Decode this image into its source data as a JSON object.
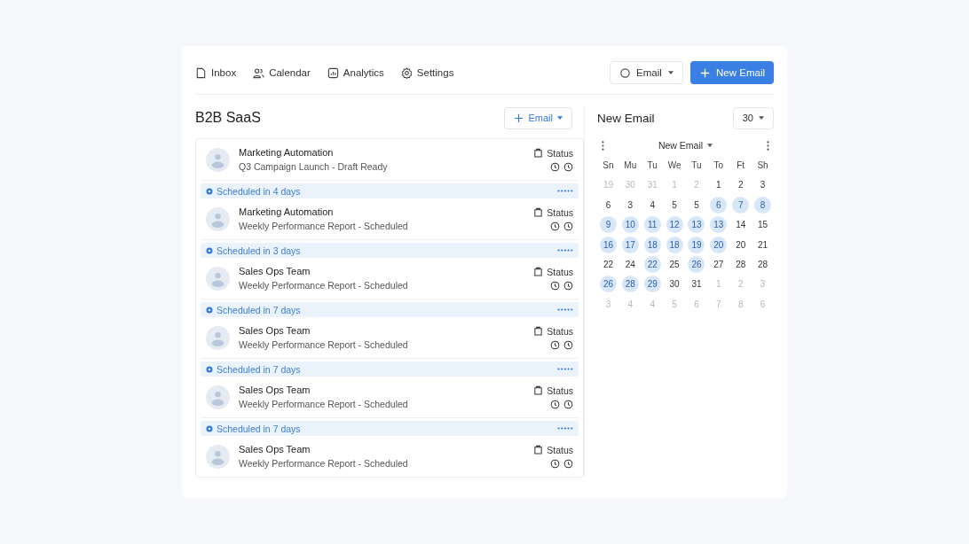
{
  "nav": [
    {
      "label": "Inbox"
    },
    {
      "label": "Calendar"
    },
    {
      "label": "Analytics"
    },
    {
      "label": "Settings"
    }
  ],
  "header_actions": {
    "select": "Email",
    "primary": "New Email"
  },
  "list_panel": {
    "title": "B2B SaaS",
    "add_button": "Email",
    "items": [
      {
        "sender": "Marketing Automation",
        "subject": "Q3 Campaign Launch - Draft Ready",
        "status": "Status"
      },
      {
        "schedule": "Scheduled in 4 days",
        "sender": "Marketing Automation",
        "subject": "Weekly Performance Report - Scheduled",
        "status": "Status"
      },
      {
        "schedule": "Scheduled in 3 days",
        "sender": "Sales Ops Team",
        "subject": "Weekly Performance Report - Scheduled",
        "status": "Status"
      },
      {
        "schedule": "Scheduled in 7 days",
        "sender": "Sales Ops Team",
        "subject": "Weekly Performance Report - Scheduled",
        "status": "Status"
      },
      {
        "schedule": "Scheduled in 7 days",
        "sender": "Sales Ops Team",
        "subject": "Weekly Performance Report - Scheduled",
        "status": "Status"
      },
      {
        "schedule": "Scheduled in 7 days",
        "sender": "Sales Ops Team",
        "subject": "Weekly Performance Report - Scheduled",
        "status": "Status"
      }
    ]
  },
  "calendar_panel": {
    "title": "New Email",
    "range_select": "30",
    "month_select": "New Email",
    "weekdays": [
      "Sn",
      "Mu",
      "Tu",
      "We",
      "Tu",
      "To",
      "Ft",
      "Sh"
    ],
    "weeks": [
      [
        {
          "label": "19",
          "muted": true,
          "highlighted": false
        },
        {
          "label": "30",
          "muted": true,
          "highlighted": false
        },
        {
          "label": "31",
          "muted": true,
          "highlighted": false
        },
        {
          "label": "1",
          "muted": true,
          "highlighted": false
        },
        {
          "label": "2",
          "muted": true,
          "highlighted": false
        },
        {
          "label": "1",
          "muted": false,
          "highlighted": false
        },
        {
          "label": "2",
          "muted": false,
          "highlighted": false
        },
        {
          "label": "3",
          "muted": false,
          "highlighted": false
        }
      ],
      [
        {
          "label": "6",
          "muted": false,
          "highlighted": false
        },
        {
          "label": "3",
          "muted": false,
          "highlighted": false
        },
        {
          "label": "4",
          "muted": false,
          "highlighted": false
        },
        {
          "label": "5",
          "muted": false,
          "highlighted": false
        },
        {
          "label": "5",
          "muted": false,
          "highlighted": false
        },
        {
          "label": "6",
          "muted": false,
          "highlighted": true
        },
        {
          "label": "7",
          "muted": false,
          "highlighted": true
        },
        {
          "label": "8",
          "muted": false,
          "highlighted": true
        }
      ],
      [
        {
          "label": "9",
          "muted": false,
          "highlighted": true
        },
        {
          "label": "10",
          "muted": false,
          "highlighted": true
        },
        {
          "label": "11",
          "muted": false,
          "highlighted": true
        },
        {
          "label": "12",
          "muted": false,
          "highlighted": true
        },
        {
          "label": "13",
          "muted": false,
          "highlighted": true
        },
        {
          "label": "13",
          "muted": false,
          "highlighted": true
        },
        {
          "label": "14",
          "muted": false,
          "highlighted": false
        },
        {
          "label": "15",
          "muted": false,
          "highlighted": false
        }
      ],
      [
        {
          "label": "16",
          "muted": false,
          "highlighted": true
        },
        {
          "label": "17",
          "muted": false,
          "highlighted": true
        },
        {
          "label": "18",
          "muted": false,
          "highlighted": true
        },
        {
          "label": "18",
          "muted": false,
          "highlighted": true
        },
        {
          "label": "19",
          "muted": false,
          "highlighted": true
        },
        {
          "label": "20",
          "muted": false,
          "highlighted": true
        },
        {
          "label": "20",
          "muted": false,
          "highlighted": false
        },
        {
          "label": "21",
          "muted": false,
          "highlighted": false
        }
      ],
      [
        {
          "label": "22",
          "muted": false,
          "highlighted": false
        },
        {
          "label": "24",
          "muted": false,
          "highlighted": false
        },
        {
          "label": "22",
          "muted": false,
          "highlighted": true
        },
        {
          "label": "25",
          "muted": false,
          "highlighted": false
        },
        {
          "label": "26",
          "muted": false,
          "highlighted": true
        },
        {
          "label": "27",
          "muted": false,
          "highlighted": false
        },
        {
          "label": "28",
          "muted": false,
          "highlighted": false
        },
        {
          "label": "28",
          "muted": false,
          "highlighted": false
        }
      ],
      [
        {
          "label": "26",
          "muted": false,
          "highlighted": true
        },
        {
          "label": "28",
          "muted": false,
          "highlighted": true
        },
        {
          "label": "29",
          "muted": false,
          "highlighted": true
        },
        {
          "label": "30",
          "muted": false,
          "highlighted": false
        },
        {
          "label": "31",
          "muted": false,
          "highlighted": false
        },
        {
          "label": "1",
          "muted": true,
          "highlighted": false
        },
        {
          "label": "2",
          "muted": true,
          "highlighted": false
        },
        {
          "label": "3",
          "muted": true,
          "highlighted": false
        }
      ],
      [
        {
          "label": "3",
          "muted": true,
          "highlighted": false
        },
        {
          "label": "4",
          "muted": true,
          "highlighted": false
        },
        {
          "label": "4",
          "muted": true,
          "highlighted": false
        },
        {
          "label": "5",
          "muted": true,
          "highlighted": false
        },
        {
          "label": "6",
          "muted": true,
          "highlighted": false
        },
        {
          "label": "7",
          "muted": true,
          "highlighted": false
        },
        {
          "label": "8",
          "muted": true,
          "highlighted": false
        },
        {
          "label": "6",
          "muted": true,
          "highlighted": false
        }
      ]
    ]
  }
}
